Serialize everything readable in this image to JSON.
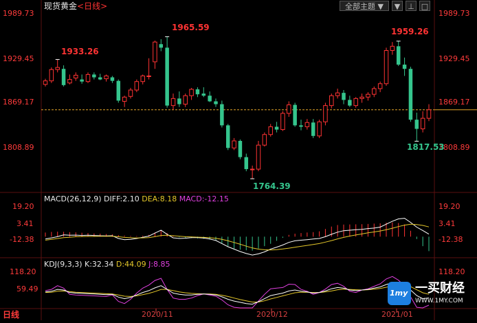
{
  "instrument": {
    "name": "现货黄金",
    "period": "<日线>"
  },
  "topbar": {
    "menu_label": "全部主题",
    "menu_arrow": "▼",
    "btn2": "▼",
    "btn3": "⊥",
    "btn4": "□"
  },
  "price_axis": {
    "left": [
      "1989.73",
      "1929.45",
      "1869.17",
      "1808.89"
    ],
    "right": [
      "1989.73",
      "1929.45",
      "1869.17",
      "1808.89"
    ]
  },
  "annotations": {
    "high1": "1933.26",
    "high2": "1965.59",
    "low1": "1764.39",
    "high3": "1959.26",
    "low2": "1817.53"
  },
  "macd": {
    "title": "MACD(26,12,9)",
    "diff": "DIFF:2.10",
    "dea": "DEA:8.18",
    "macd": "MACD:-12.15",
    "axis": [
      "19.20",
      "3.41",
      "-12.38"
    ]
  },
  "kdj": {
    "title": "KDJ(9,3,3)",
    "k": "K:32.34",
    "d": "D:44.09",
    "j": "J:8.85",
    "axis": [
      "118.20",
      "59.49"
    ]
  },
  "xaxis": {
    "period_btn": "日线",
    "labels": [
      "2020/11",
      "2020/12",
      "2021/01"
    ]
  },
  "watermark": {
    "brand": "一买财经",
    "url": "WWW.1MY.COM",
    "logo_text": "1my"
  },
  "colors": {
    "up": "#ff3333",
    "down": "#35c58d",
    "dif": "#ffffff",
    "dea": "#e5c82a",
    "j": "#e040e0",
    "grid": "#5a1010"
  },
  "chart_data": {
    "type": "candlestick",
    "ylim": [
      1745,
      2000
    ],
    "candles": [
      {
        "o": 1898,
        "h": 1906,
        "l": 1895,
        "c": 1903
      },
      {
        "o": 1903,
        "h": 1922,
        "l": 1900,
        "c": 1919
      },
      {
        "o": 1919,
        "h": 1933.26,
        "l": 1915,
        "c": 1922
      },
      {
        "o": 1920,
        "h": 1925,
        "l": 1895,
        "c": 1897
      },
      {
        "o": 1900,
        "h": 1912,
        "l": 1898,
        "c": 1905
      },
      {
        "o": 1907,
        "h": 1915,
        "l": 1903,
        "c": 1911
      },
      {
        "o": 1905,
        "h": 1912,
        "l": 1899,
        "c": 1902
      },
      {
        "o": 1902,
        "h": 1915,
        "l": 1900,
        "c": 1912
      },
      {
        "o": 1912,
        "h": 1915,
        "l": 1905,
        "c": 1908
      },
      {
        "o": 1908,
        "h": 1913,
        "l": 1904,
        "c": 1905
      },
      {
        "o": 1906,
        "h": 1912,
        "l": 1902,
        "c": 1910
      },
      {
        "o": 1908,
        "h": 1910,
        "l": 1900,
        "c": 1903
      },
      {
        "o": 1903,
        "h": 1905,
        "l": 1872,
        "c": 1875
      },
      {
        "o": 1874,
        "h": 1882,
        "l": 1866,
        "c": 1880
      },
      {
        "o": 1881,
        "h": 1893,
        "l": 1878,
        "c": 1890
      },
      {
        "o": 1890,
        "h": 1905,
        "l": 1887,
        "c": 1902
      },
      {
        "o": 1902,
        "h": 1912,
        "l": 1898,
        "c": 1910
      },
      {
        "o": 1910,
        "h": 1935,
        "l": 1905,
        "c": 1910
      },
      {
        "o": 1930,
        "h": 1960,
        "l": 1920,
        "c": 1958
      },
      {
        "o": 1955,
        "h": 1962,
        "l": 1945,
        "c": 1950
      },
      {
        "o": 1950,
        "h": 1965.59,
        "l": 1865,
        "c": 1868
      },
      {
        "o": 1868,
        "h": 1885,
        "l": 1862,
        "c": 1878
      },
      {
        "o": 1878,
        "h": 1888,
        "l": 1866,
        "c": 1870
      },
      {
        "o": 1870,
        "h": 1885,
        "l": 1866,
        "c": 1882
      },
      {
        "o": 1882,
        "h": 1893,
        "l": 1876,
        "c": 1891
      },
      {
        "o": 1891,
        "h": 1894,
        "l": 1880,
        "c": 1884
      },
      {
        "o": 1885,
        "h": 1894,
        "l": 1880,
        "c": 1882
      },
      {
        "o": 1882,
        "h": 1888,
        "l": 1873,
        "c": 1874
      },
      {
        "o": 1874,
        "h": 1878,
        "l": 1866,
        "c": 1870
      },
      {
        "o": 1870,
        "h": 1875,
        "l": 1837,
        "c": 1840
      },
      {
        "o": 1840,
        "h": 1842,
        "l": 1805,
        "c": 1808
      },
      {
        "o": 1808,
        "h": 1822,
        "l": 1805,
        "c": 1818
      },
      {
        "o": 1818,
        "h": 1820,
        "l": 1792,
        "c": 1795
      },
      {
        "o": 1795,
        "h": 1800,
        "l": 1775,
        "c": 1778
      },
      {
        "o": 1778,
        "h": 1783,
        "l": 1764.39,
        "c": 1778
      },
      {
        "o": 1778,
        "h": 1818,
        "l": 1775,
        "c": 1812
      },
      {
        "o": 1812,
        "h": 1830,
        "l": 1810,
        "c": 1827
      },
      {
        "o": 1827,
        "h": 1842,
        "l": 1824,
        "c": 1838
      },
      {
        "o": 1838,
        "h": 1845,
        "l": 1830,
        "c": 1834
      },
      {
        "o": 1834,
        "h": 1860,
        "l": 1832,
        "c": 1857
      },
      {
        "o": 1857,
        "h": 1874,
        "l": 1852,
        "c": 1869
      },
      {
        "o": 1869,
        "h": 1872,
        "l": 1838,
        "c": 1840
      },
      {
        "o": 1840,
        "h": 1848,
        "l": 1833,
        "c": 1838
      },
      {
        "o": 1838,
        "h": 1849,
        "l": 1834,
        "c": 1844
      },
      {
        "o": 1844,
        "h": 1849,
        "l": 1822,
        "c": 1825
      },
      {
        "o": 1825,
        "h": 1848,
        "l": 1822,
        "c": 1845
      },
      {
        "o": 1845,
        "h": 1872,
        "l": 1840,
        "c": 1868
      },
      {
        "o": 1868,
        "h": 1885,
        "l": 1864,
        "c": 1882
      },
      {
        "o": 1882,
        "h": 1892,
        "l": 1878,
        "c": 1886
      },
      {
        "o": 1886,
        "h": 1890,
        "l": 1870,
        "c": 1876
      },
      {
        "o": 1876,
        "h": 1882,
        "l": 1866,
        "c": 1868
      },
      {
        "o": 1868,
        "h": 1880,
        "l": 1865,
        "c": 1878
      },
      {
        "o": 1878,
        "h": 1885,
        "l": 1872,
        "c": 1880
      },
      {
        "o": 1880,
        "h": 1887,
        "l": 1875,
        "c": 1884
      },
      {
        "o": 1884,
        "h": 1895,
        "l": 1880,
        "c": 1892
      },
      {
        "o": 1892,
        "h": 1902,
        "l": 1887,
        "c": 1899
      },
      {
        "o": 1899,
        "h": 1950,
        "l": 1896,
        "c": 1946
      },
      {
        "o": 1946,
        "h": 1958,
        "l": 1940,
        "c": 1952
      },
      {
        "o": 1952,
        "h": 1959.26,
        "l": 1924,
        "c": 1926
      },
      {
        "o": 1926,
        "h": 1936,
        "l": 1910,
        "c": 1920
      },
      {
        "o": 1920,
        "h": 1923,
        "l": 1845,
        "c": 1848
      },
      {
        "o": 1848,
        "h": 1858,
        "l": 1817.53,
        "c": 1835
      },
      {
        "o": 1835,
        "h": 1860,
        "l": 1830,
        "c": 1850
      },
      {
        "o": 1850,
        "h": 1870,
        "l": 1846,
        "c": 1862
      }
    ],
    "macd": {
      "ylim": [
        -16,
        28
      ],
      "hist": [
        3.5,
        4,
        4.2,
        4.1,
        3.8,
        3.6,
        3.3,
        3,
        2.7,
        2.5,
        2.2,
        1.9,
        1.3,
        0.9,
        0.6,
        0.5,
        0.8,
        1.5,
        3.5,
        5.5,
        3,
        0.5,
        -0.6,
        -1,
        -1.2,
        -1.5,
        -1.8,
        -2.3,
        -3.2,
        -5.5,
        -8,
        -10,
        -11,
        -11.5,
        -11.8,
        -10,
        -8,
        -6,
        -3.5,
        -1,
        1.5,
        2.5,
        3,
        3.5,
        3.8,
        4.5,
        6.5,
        8.5,
        9.8,
        10.2,
        10.3,
        10.4,
        10.5,
        10.7,
        11,
        11.2,
        11.8,
        12,
        11.5,
        10.3,
        5,
        -2,
        -8,
        -12.15
      ],
      "dif": [
        -2,
        -1,
        0,
        1.5,
        1.2,
        1.3,
        1,
        1.2,
        1,
        0.8,
        0.7,
        0.8,
        -1.5,
        -2.5,
        -2.2,
        -1.5,
        -0.5,
        0.5,
        3,
        5.5,
        2,
        -1,
        -1.5,
        -1.3,
        -0.8,
        -0.8,
        -1.2,
        -2,
        -3.2,
        -5.8,
        -8.5,
        -10.5,
        -12.5,
        -14.2,
        -15.5,
        -14.5,
        -12.8,
        -10.5,
        -8.8,
        -7,
        -4.8,
        -3.5,
        -3,
        -2.5,
        -2,
        -1.5,
        0,
        2,
        3.8,
        5,
        5.4,
        5.8,
        6.2,
        6.8,
        7.2,
        8,
        10.5,
        13,
        15,
        15.5,
        12,
        8,
        5.2,
        2.1
      ],
      "dea": [
        -3,
        -2.2,
        -1.6,
        -0.8,
        -0.5,
        -0.1,
        0.1,
        0.2,
        0.2,
        0.3,
        0.3,
        0.3,
        -0.1,
        -0.6,
        -0.9,
        -1.1,
        -1,
        -0.8,
        0,
        1,
        1.2,
        0.8,
        0.3,
        0,
        -0.2,
        -0.4,
        -0.6,
        -0.9,
        -1.4,
        -2.3,
        -3.5,
        -4.9,
        -6.4,
        -8,
        -9.5,
        -10.5,
        -11,
        -11.2,
        -10.9,
        -10.4,
        -9.7,
        -8.9,
        -8.1,
        -7.4,
        -6.6,
        -5.8,
        -4.6,
        -3.3,
        -1.9,
        -0.6,
        0.5,
        1.4,
        2.3,
        3.2,
        4,
        4.8,
        5.9,
        7.1,
        8.5,
        9.7,
        10.5,
        10.2,
        9.5,
        8.18
      ]
    },
    "kdj": {
      "ylim": [
        0,
        125
      ],
      "k": [
        52,
        54,
        60,
        58,
        50,
        48,
        47,
        46,
        45,
        44,
        43,
        44,
        35,
        30,
        34,
        42,
        50,
        56,
        65,
        72,
        60,
        48,
        44,
        42,
        42,
        44,
        45,
        44,
        42,
        36,
        28,
        22,
        18,
        14,
        12,
        20,
        30,
        40,
        44,
        48,
        55,
        58,
        54,
        52,
        48,
        50,
        55,
        62,
        66,
        64,
        58,
        56,
        58,
        60,
        64,
        68,
        76,
        82,
        80,
        74,
        58,
        40,
        30,
        32.34
      ],
      "d": [
        50,
        51,
        54,
        55,
        53,
        51,
        50,
        49,
        48,
        47,
        46,
        45,
        42,
        38,
        37,
        39,
        43,
        47,
        53,
        60,
        60,
        56,
        52,
        49,
        47,
        46,
        45,
        45,
        44,
        41,
        37,
        32,
        27,
        23,
        19,
        19,
        23,
        29,
        34,
        39,
        44,
        49,
        51,
        51,
        50,
        50,
        52,
        55,
        59,
        61,
        60,
        59,
        58,
        59,
        61,
        63,
        67,
        72,
        75,
        75,
        69,
        59,
        49,
        44.09
      ],
      "j": [
        56,
        60,
        72,
        64,
        44,
        42,
        41,
        40,
        39,
        38,
        37,
        42,
        21,
        14,
        28,
        48,
        64,
        74,
        89,
        96,
        60,
        32,
        28,
        28,
        32,
        40,
        45,
        42,
        38,
        26,
        10,
        2,
        0,
        0,
        0,
        22,
        44,
        62,
        64,
        66,
        77,
        76,
        60,
        54,
        44,
        50,
        61,
        76,
        80,
        70,
        54,
        50,
        58,
        62,
        70,
        78,
        94,
        102,
        90,
        72,
        36,
        2,
        0,
        8.85
      ]
    }
  }
}
